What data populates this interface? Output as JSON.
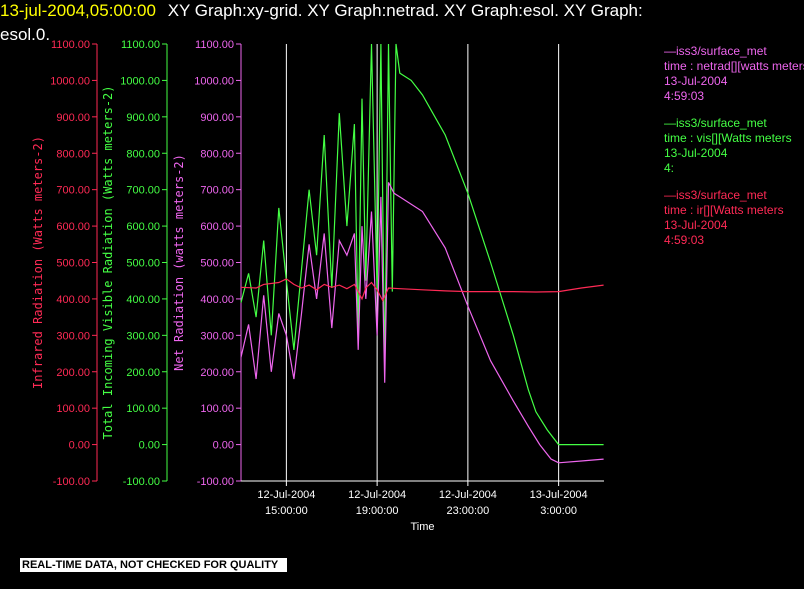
{
  "header": {
    "line1_date": "13-jul-2004,05:00:00",
    "line1_rest": "XY Graph:xy-grid.  XY Graph:netrad.  XY Graph:esol.  XY Graph:",
    "line2": "esol.0."
  },
  "notice": "REAL-TIME DATA, NOT CHECKED FOR QUALITY",
  "colors": {
    "background": "#000000",
    "ir": "#ff2a55",
    "vis": "#44ff44",
    "net": "#ee66ee",
    "axis": "#ffffff",
    "header_date": "#ffff00"
  },
  "legend": [
    {
      "source": "—iss3/surface_met",
      "desc": "time : netrad[][watts meters",
      "date": "13-Jul-2004",
      "time": "4:59:03",
      "color": "#ee66ee"
    },
    {
      "source": "—iss3/surface_met",
      "desc": "time : vis[][Watts meters",
      "date": "13-Jul-2004",
      "time": "4:",
      "color": "#44ff44"
    },
    {
      "source": "—iss3/surface_met",
      "desc": "time : ir[][Watts meters",
      "date": "13-Jul-2004",
      "time": "4:59:03",
      "color": "#ff2a55"
    }
  ],
  "chart_data": {
    "type": "line",
    "xlabel": "Time",
    "x_range": [
      "2004-07-12 13:00",
      "2004-07-13 05:00"
    ],
    "x_ticks": [
      {
        "t": "2004-07-12 15:00",
        "label1": "12-Jul-2004",
        "label2": "15:00:00"
      },
      {
        "t": "2004-07-12 19:00",
        "label1": "12-Jul-2004",
        "label2": "19:00:00"
      },
      {
        "t": "2004-07-12 23:00",
        "label1": "12-Jul-2004",
        "label2": "23:00:00"
      },
      {
        "t": "2004-07-13 03:00",
        "label1": "13-Jul-2004",
        "label2": "3:00:00"
      }
    ],
    "grid": "vertical lines at x ticks",
    "y_axes": [
      {
        "id": "ir",
        "label": "Infrared Radiation (Watts meters-2)",
        "color": "#ff2a55",
        "ylim": [
          -100,
          1100
        ],
        "ticks": [
          "-100.00",
          "0.00",
          "100.00",
          "200.00",
          "300.00",
          "400.00",
          "500.00",
          "600.00",
          "700.00",
          "800.00",
          "900.00",
          "1000.00",
          "1100.00"
        ]
      },
      {
        "id": "vis",
        "label": "Total Incoming Visible Radiation (Watts meters-2)",
        "color": "#44ff44",
        "ylim": [
          -100,
          1100
        ],
        "ticks": [
          "-100.00",
          "0.00",
          "100.00",
          "200.00",
          "300.00",
          "400.00",
          "500.00",
          "600.00",
          "700.00",
          "800.00",
          "900.00",
          "1000.00",
          "1100.00"
        ]
      },
      {
        "id": "net",
        "label": "Net Radiation (watts meters-2)",
        "color": "#ee66ee",
        "ylim": [
          -100,
          1100
        ],
        "ticks": [
          "-100.00",
          "0.00",
          "100.00",
          "200.00",
          "300.00",
          "400.00",
          "500.00",
          "600.00",
          "700.00",
          "800.00",
          "900.00",
          "1000.00",
          "1100.00"
        ]
      }
    ],
    "series": [
      {
        "axis": "vis",
        "color": "#44ff44",
        "points": [
          [
            "2004-07-12 13:00",
            390
          ],
          [
            "2004-07-12 13:20",
            470
          ],
          [
            "2004-07-12 13:40",
            350
          ],
          [
            "2004-07-12 14:00",
            560
          ],
          [
            "2004-07-12 14:20",
            300
          ],
          [
            "2004-07-12 14:40",
            650
          ],
          [
            "2004-07-12 15:00",
            450
          ],
          [
            "2004-07-12 15:20",
            260
          ],
          [
            "2004-07-12 15:40",
            480
          ],
          [
            "2004-07-12 16:00",
            700
          ],
          [
            "2004-07-12 16:20",
            520
          ],
          [
            "2004-07-12 16:40",
            850
          ],
          [
            "2004-07-12 17:00",
            430
          ],
          [
            "2004-07-12 17:20",
            910
          ],
          [
            "2004-07-12 17:40",
            600
          ],
          [
            "2004-07-12 18:00",
            880
          ],
          [
            "2004-07-12 18:10",
            300
          ],
          [
            "2004-07-12 18:20",
            950
          ],
          [
            "2004-07-12 18:30",
            450
          ],
          [
            "2004-07-12 18:45",
            1100
          ],
          [
            "2004-07-12 19:00",
            420
          ],
          [
            "2004-07-12 19:10",
            1100
          ],
          [
            "2004-07-12 19:20",
            200
          ],
          [
            "2004-07-12 19:30",
            1100
          ],
          [
            "2004-07-12 19:40",
            420
          ],
          [
            "2004-07-12 19:50",
            1100
          ],
          [
            "2004-07-12 20:00",
            1020
          ],
          [
            "2004-07-12 20:30",
            1000
          ],
          [
            "2004-07-12 21:00",
            960
          ],
          [
            "2004-07-12 22:00",
            850
          ],
          [
            "2004-07-12 23:00",
            690
          ],
          [
            "2004-07-13 00:00",
            500
          ],
          [
            "2004-07-13 01:00",
            300
          ],
          [
            "2004-07-13 01:40",
            150
          ],
          [
            "2004-07-13 02:00",
            90
          ],
          [
            "2004-07-13 02:30",
            40
          ],
          [
            "2004-07-13 03:00",
            0
          ],
          [
            "2004-07-13 04:00",
            0
          ],
          [
            "2004-07-13 04:59",
            0
          ]
        ]
      },
      {
        "axis": "net",
        "color": "#ee66ee",
        "points": [
          [
            "2004-07-12 13:00",
            240
          ],
          [
            "2004-07-12 13:20",
            330
          ],
          [
            "2004-07-12 13:40",
            180
          ],
          [
            "2004-07-12 14:00",
            410
          ],
          [
            "2004-07-12 14:20",
            200
          ],
          [
            "2004-07-12 14:40",
            360
          ],
          [
            "2004-07-12 15:00",
            300
          ],
          [
            "2004-07-12 15:20",
            180
          ],
          [
            "2004-07-12 15:40",
            360
          ],
          [
            "2004-07-12 16:00",
            550
          ],
          [
            "2004-07-12 16:20",
            400
          ],
          [
            "2004-07-12 16:40",
            580
          ],
          [
            "2004-07-12 17:00",
            320
          ],
          [
            "2004-07-12 17:20",
            560
          ],
          [
            "2004-07-12 17:40",
            520
          ],
          [
            "2004-07-12 18:00",
            580
          ],
          [
            "2004-07-12 18:10",
            260
          ],
          [
            "2004-07-12 18:20",
            600
          ],
          [
            "2004-07-12 18:30",
            400
          ],
          [
            "2004-07-12 18:45",
            640
          ],
          [
            "2004-07-12 19:00",
            300
          ],
          [
            "2004-07-12 19:10",
            680
          ],
          [
            "2004-07-12 19:20",
            170
          ],
          [
            "2004-07-12 19:30",
            720
          ],
          [
            "2004-07-12 19:45",
            690
          ],
          [
            "2004-07-12 20:00",
            680
          ],
          [
            "2004-07-12 21:00",
            640
          ],
          [
            "2004-07-12 22:00",
            540
          ],
          [
            "2004-07-12 23:00",
            380
          ],
          [
            "2004-07-13 00:00",
            230
          ],
          [
            "2004-07-13 01:00",
            120
          ],
          [
            "2004-07-13 01:40",
            50
          ],
          [
            "2004-07-13 02:10",
            0
          ],
          [
            "2004-07-13 02:40",
            -40
          ],
          [
            "2004-07-13 03:00",
            -50
          ],
          [
            "2004-07-13 04:00",
            -45
          ],
          [
            "2004-07-13 04:59",
            -40
          ]
        ]
      },
      {
        "axis": "ir",
        "color": "#ff2a55",
        "points": [
          [
            "2004-07-12 13:00",
            432
          ],
          [
            "2004-07-12 13:40",
            430
          ],
          [
            "2004-07-12 14:00",
            440
          ],
          [
            "2004-07-12 14:40",
            445
          ],
          [
            "2004-07-12 15:00",
            455
          ],
          [
            "2004-07-12 15:20",
            440
          ],
          [
            "2004-07-12 15:40",
            430
          ],
          [
            "2004-07-12 16:00",
            438
          ],
          [
            "2004-07-12 16:20",
            425
          ],
          [
            "2004-07-12 16:40",
            440
          ],
          [
            "2004-07-12 17:00",
            432
          ],
          [
            "2004-07-12 17:20",
            438
          ],
          [
            "2004-07-12 17:40",
            428
          ],
          [
            "2004-07-12 18:00",
            440
          ],
          [
            "2004-07-12 18:20",
            400
          ],
          [
            "2004-07-12 18:30",
            430
          ],
          [
            "2004-07-12 18:45",
            445
          ],
          [
            "2004-07-12 19:00",
            425
          ],
          [
            "2004-07-12 19:15",
            395
          ],
          [
            "2004-07-12 19:30",
            430
          ],
          [
            "2004-07-12 20:00",
            428
          ],
          [
            "2004-07-12 21:00",
            425
          ],
          [
            "2004-07-12 22:00",
            422
          ],
          [
            "2004-07-12 23:00",
            420
          ],
          [
            "2004-07-13 00:00",
            420
          ],
          [
            "2004-07-13 01:00",
            420
          ],
          [
            "2004-07-13 02:00",
            419
          ],
          [
            "2004-07-13 03:00",
            420
          ],
          [
            "2004-07-13 04:00",
            430
          ],
          [
            "2004-07-13 04:59",
            438
          ]
        ]
      }
    ]
  }
}
